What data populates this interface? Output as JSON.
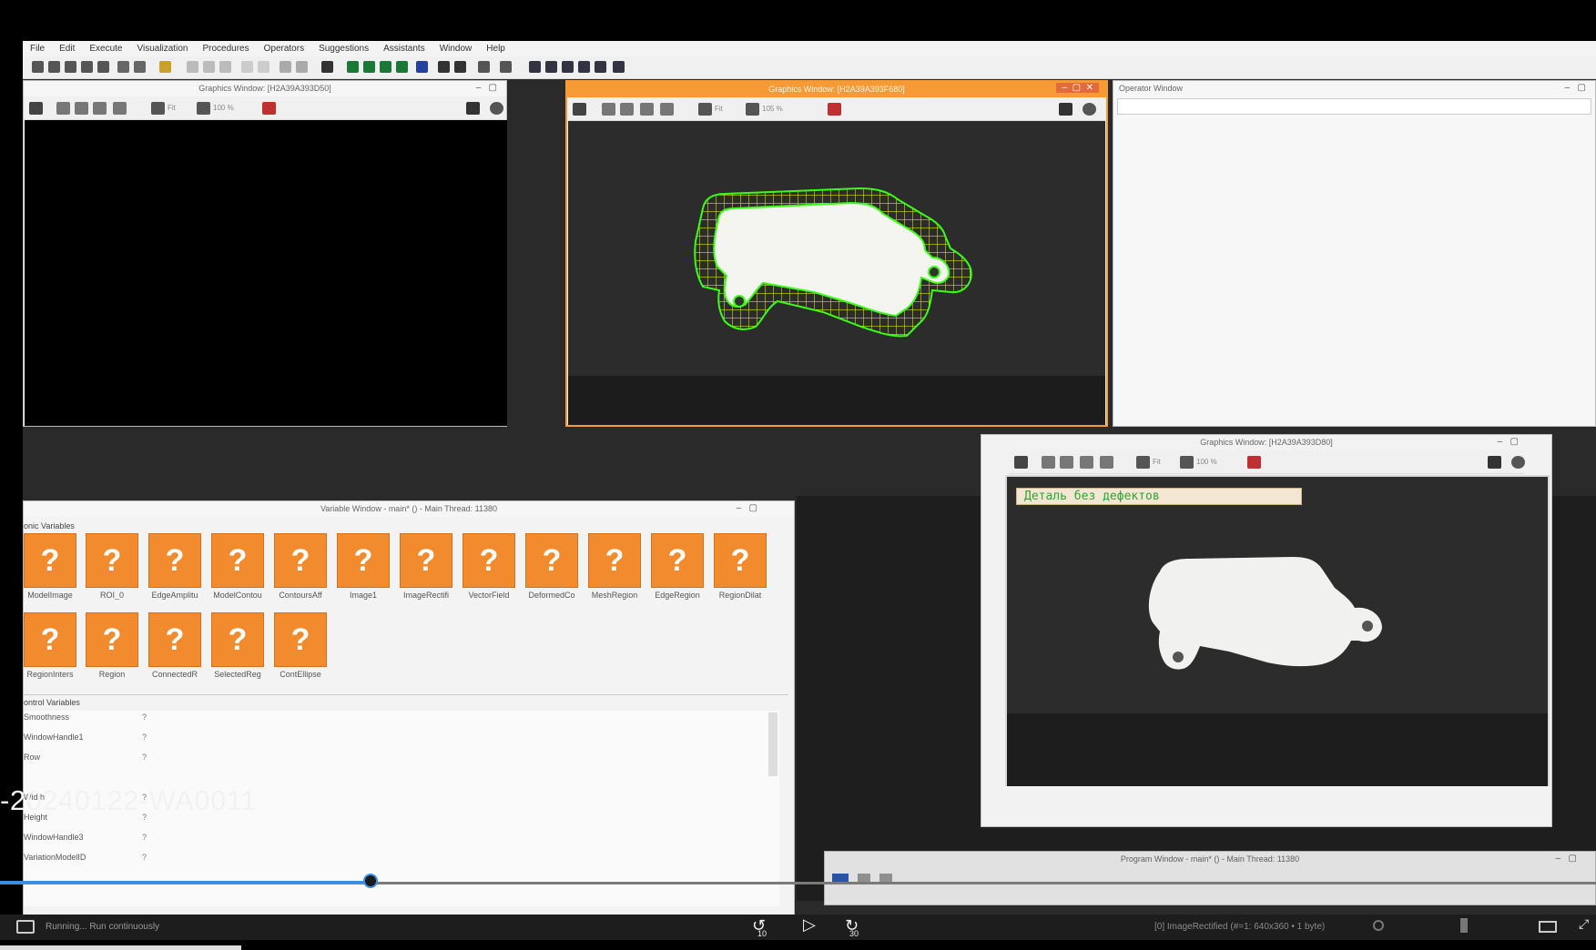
{
  "menu": [
    "File",
    "Edit",
    "Execute",
    "Visualization",
    "Procedures",
    "Operators",
    "Suggestions",
    "Assistants",
    "Window",
    "Help"
  ],
  "graphics_windows": {
    "left": {
      "title": "Graphics Window: [H2A39A393D50]",
      "fit": "Fit",
      "zoom": "100 %"
    },
    "center": {
      "title": "Graphics Window: [H2A39A393F680]",
      "fit": "Fit",
      "zoom": "105 %"
    },
    "bottom": {
      "title": "Graphics Window: [H2A39A393D80]",
      "fit": "Fit",
      "zoom": "100 %"
    }
  },
  "operator_window": {
    "title": "Operator Window"
  },
  "variable_window": {
    "title": "Variable Window - main* () - Main Thread: 11380",
    "iconic_section": "onic Variables",
    "iconic": [
      "ModelImage",
      "ROI_0",
      "EdgeAmplitu",
      "ModelContou",
      "ContoursAff",
      "Image1",
      "ImageRectifi",
      "VectorField",
      "DeformedCo",
      "MeshRegion",
      "EdgeRegion",
      "RegionDilat",
      "RegionInters",
      "Region",
      "ConnectedR",
      "SelectedReg",
      "ContEllipse"
    ],
    "control_section": "ontrol Variables",
    "control": [
      {
        "name": "Smoothness",
        "value": "?"
      },
      {
        "name": "WindowHandle1",
        "value": "?"
      },
      {
        "name": "Row",
        "value": "?"
      },
      {
        "name": "Width",
        "value": "?"
      },
      {
        "name": "Height",
        "value": "?"
      },
      {
        "name": "WindowHandle3",
        "value": "?"
      },
      {
        "name": "VariationModelID",
        "value": "?"
      }
    ]
  },
  "program_window": {
    "title": "Program Window - main* () - Main Thread: 11380"
  },
  "result_label": "Деталь без дефектов",
  "status": {
    "left": "Running... Run continuously",
    "right": "[0] ImageRectified (#=1: 640x360 • 1 byte)"
  },
  "video": {
    "title": "-20240122-WA0011",
    "progress": 0.232,
    "rewind": "10",
    "forward": "30"
  }
}
